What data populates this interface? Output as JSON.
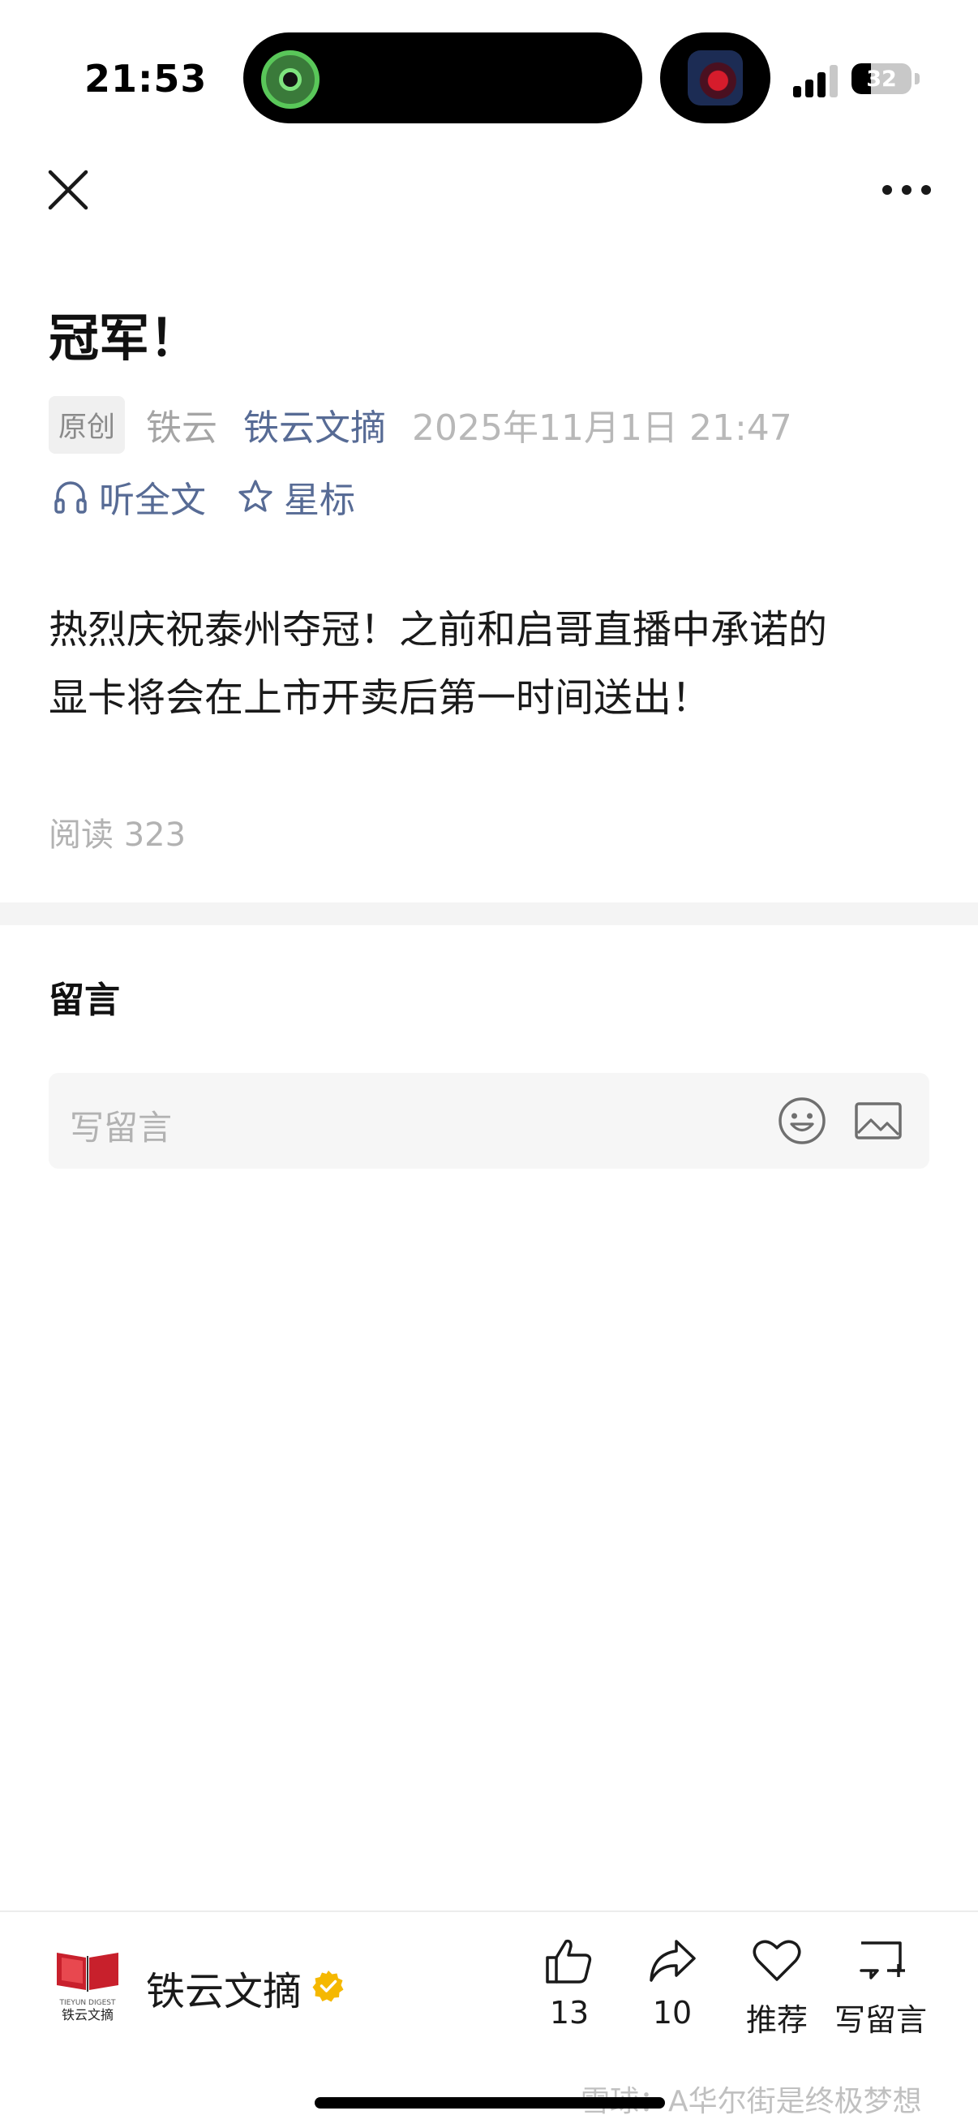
{
  "status_bar": {
    "time": "21:53",
    "battery_level": "32",
    "signal_bars_active": 3
  },
  "header": {
    "close_icon": "close-icon",
    "more_icon": "more-icon"
  },
  "article": {
    "title": "冠军！",
    "badge": "原创",
    "author": "铁云",
    "account": "铁云文摘",
    "date": "2025年11月1日 21:47",
    "listen_label": "听全文",
    "star_label": "星标",
    "body_line1": "热烈庆祝泰州夺冠！之前和启哥直播中承诺的",
    "body_line2": "显卡将会在上市开卖后第一时间送出！",
    "read_count": "阅读 323"
  },
  "comments": {
    "title": "留言",
    "placeholder": "写留言"
  },
  "bottom_bar": {
    "account_name": "铁云文摘",
    "like_count": "13",
    "share_count": "10",
    "recommend_label": "推荐",
    "write_comment_label": "写留言"
  },
  "watermark": "雪球：A华尔街是终极梦想",
  "colors": {
    "link": "#576b95",
    "muted": "#b2b2b2",
    "verified": "#f5b800"
  }
}
